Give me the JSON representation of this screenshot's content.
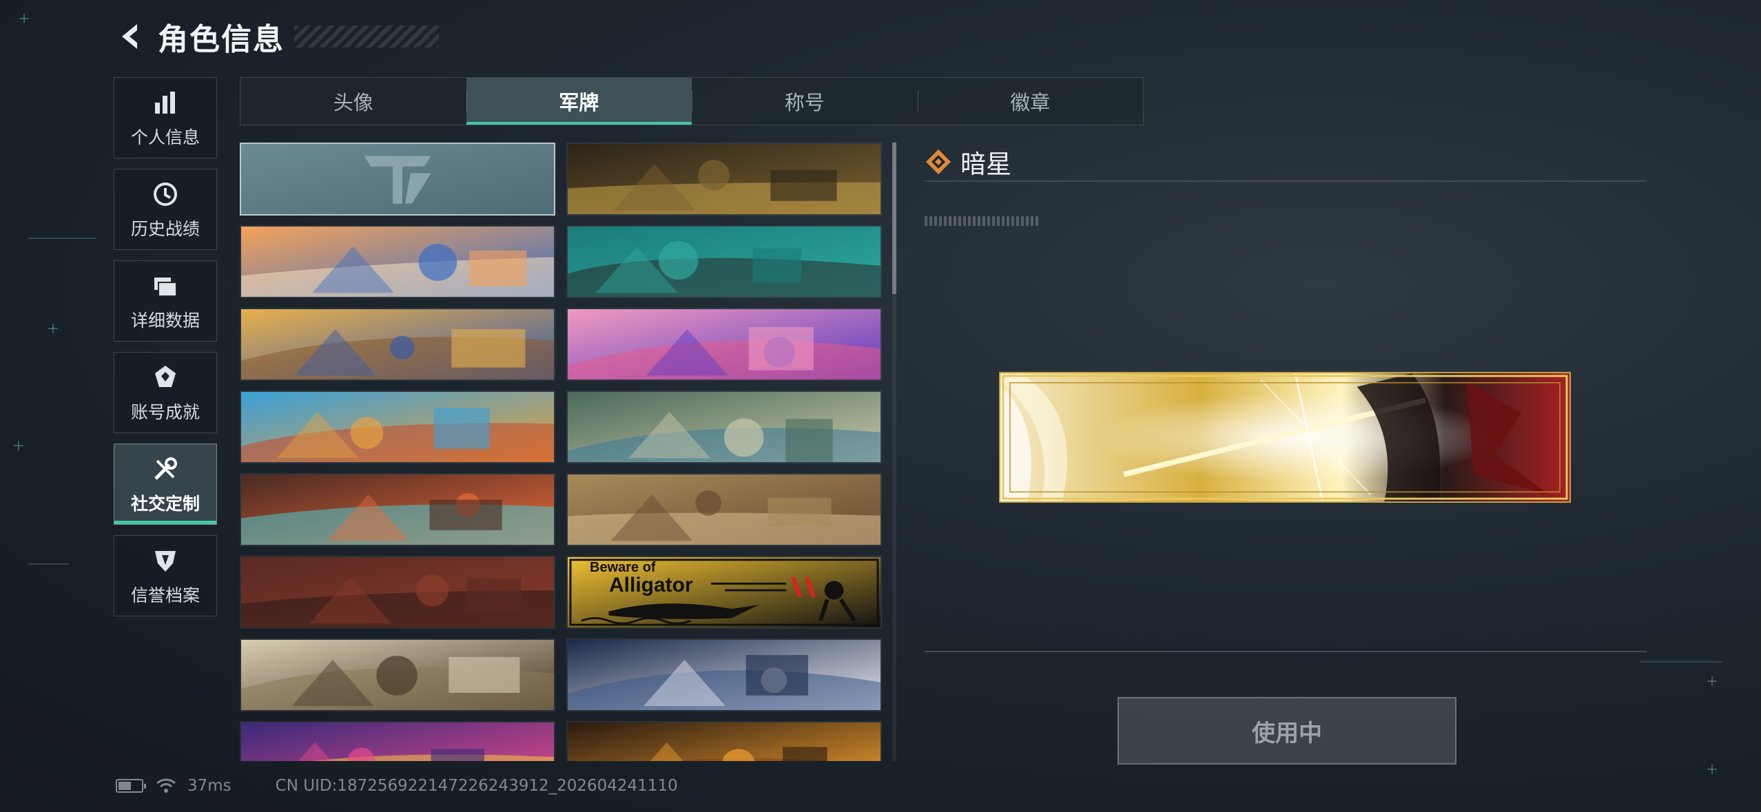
{
  "header": {
    "title": "角色信息",
    "back_icon": "chevron-left-icon"
  },
  "sidebar": {
    "items": [
      {
        "label": "个人信息",
        "icon": "bar-chart-icon",
        "active": false
      },
      {
        "label": "历史战绩",
        "icon": "clock-history-icon",
        "active": false
      },
      {
        "label": "详细数据",
        "icon": "folder-stack-icon",
        "active": false
      },
      {
        "label": "账号成就",
        "icon": "medal-icon",
        "active": false
      },
      {
        "label": "社交定制",
        "icon": "wrench-tools-icon",
        "active": true
      },
      {
        "label": "信誉档案",
        "icon": "shield-emblem-icon",
        "active": false
      }
    ]
  },
  "tabs": [
    {
      "label": "头像",
      "active": false
    },
    {
      "label": "军牌",
      "active": true
    },
    {
      "label": "称号",
      "active": false
    },
    {
      "label": "徽章",
      "active": false
    }
  ],
  "banners": [
    {
      "id": "logo-slate",
      "colors": [
        "#6a8a94",
        "#4e6c76",
        "#8aa5ad"
      ],
      "text": ""
    },
    {
      "id": "workbench-rifles",
      "colors": [
        "#2c2418",
        "#7a6230",
        "#c8a24a"
      ],
      "text": ""
    },
    {
      "id": "orange-blue-abstract",
      "colors": [
        "#f4a25a",
        "#3d6fc4",
        "#f8e0c0"
      ],
      "text": ""
    },
    {
      "id": "teal-gym",
      "colors": [
        "#1a7c78",
        "#2fa8a0",
        "#2a2a2a"
      ],
      "text": ""
    },
    {
      "id": "desert-surreal",
      "colors": [
        "#e8b04c",
        "#3a5aa8",
        "#8a5a2a"
      ],
      "text": ""
    },
    {
      "id": "pink-train",
      "colors": [
        "#f09ac0",
        "#5a3ac0",
        "#e85a8a"
      ],
      "text": ""
    },
    {
      "id": "market-stall",
      "colors": [
        "#3aa0d8",
        "#e8a040",
        "#c8482a"
      ],
      "text": ""
    },
    {
      "id": "mechanic-girl",
      "colors": [
        "#4a6a5a",
        "#c8c8a8",
        "#3a7a9a"
      ],
      "text": ""
    },
    {
      "id": "tribal-feather",
      "colors": [
        "#4a2a22",
        "#e86a3a",
        "#48c8d0"
      ],
      "text": ""
    },
    {
      "id": "desert-town",
      "colors": [
        "#a88a5a",
        "#6a4a30",
        "#d8c090"
      ],
      "text": ""
    },
    {
      "id": "soldiers-red",
      "colors": [
        "#5a2a22",
        "#8a3a2a",
        "#2a1a18"
      ],
      "text": ""
    },
    {
      "id": "alligator-sign",
      "colors": [
        "#f2c233",
        "#111111",
        "#d22"
      ],
      "text": "Beware of",
      "text2": "Alligator"
    },
    {
      "id": "knight-windmill",
      "colors": [
        "#d8ccb0",
        "#4a3a2a",
        "#8a7a5a"
      ],
      "text": ""
    },
    {
      "id": "ghost-night",
      "colors": [
        "#1a2a4a",
        "#e8e8f0",
        "#3a5a8a"
      ],
      "text": ""
    },
    {
      "id": "day-of-dead",
      "colors": [
        "#3a2a7a",
        "#e84a8a",
        "#f8c840"
      ],
      "text": ""
    },
    {
      "id": "lanterns",
      "colors": [
        "#2a1a10",
        "#f0a030",
        "#8a3a1a"
      ],
      "text": ""
    }
  ],
  "detail": {
    "name": "暗星",
    "icon": "diamond-rarity-icon",
    "preview_colors": [
      "#d8b040",
      "#fff4c0",
      "#2a1a1a",
      "#a82020"
    ]
  },
  "action": {
    "label": "使用中"
  },
  "status": {
    "battery_icon": "battery-icon",
    "wifi_icon": "wifi-icon",
    "ping": "37ms",
    "uid": "CN UID:187256922147226243912_202604241110"
  }
}
